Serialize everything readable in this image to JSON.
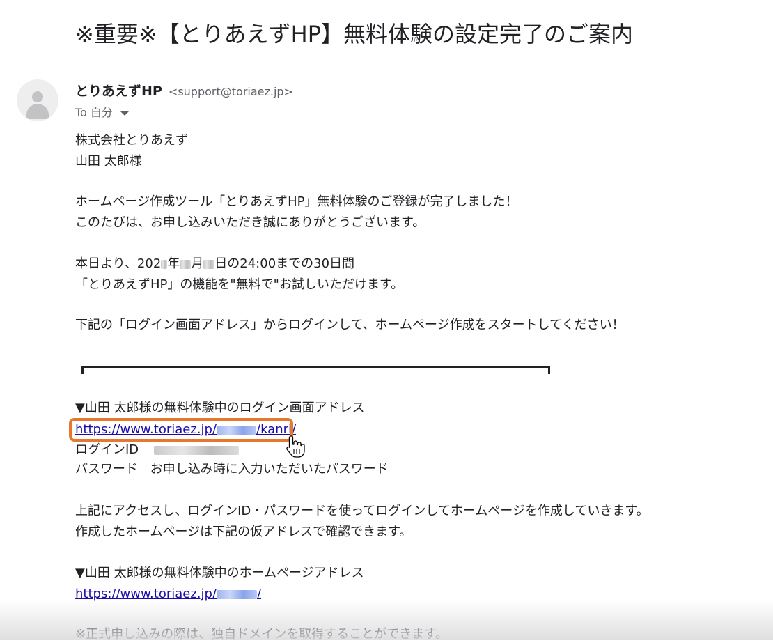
{
  "email": {
    "subject": "※重要※【とりあえずHP】無料体験の設定完了のご案内",
    "sender": {
      "name": "とりあえずHP",
      "email": "<support@toriaez.jp>"
    },
    "recipient": "To 自分",
    "body": {
      "company": "株式会社とりあえず",
      "addressee": "山田 太郎様",
      "intro_1": "ホームページ作成ツール「とりあえずHP」無料体験のご登録が完了しました！",
      "intro_2": "このたびは、お申し込みいただき誠にありがとうございます。",
      "trial_pre": "本日より、202",
      "trial_year": "年",
      "trial_month": "月",
      "trial_post": "日の24:00までの30日間",
      "trial_2": "「とりあえずHP」の機能を\"無料で\"お試しいただけます。",
      "instruction": "下記の「ログイン画面アドレス」からログインして、ホームページ作成をスタートしてください！",
      "login_heading": "▼山田 太郎様の無料体験中のログイン画面アドレス",
      "login_url_prefix": "https://www.toriaez.jp/",
      "login_url_suffix": "/kanri/",
      "login_id_label": "ログインID",
      "password_label": "パスワード",
      "password_value": "お申し込み時に入力いただいたパスワード",
      "access_1": "上記にアクセスし、ログインID・パスワードを使ってログインしてホームページを作成していきます。",
      "access_2": "作成したホームページは下記の仮アドレスで確認できます。",
      "homepage_heading": "▼山田 太郎様の無料体験中のホームページアドレス",
      "homepage_url_prefix": "https://www.toriaez.jp/",
      "homepage_url_suffix": "/",
      "note": "※正式申し込みの際は、独自ドメインを取得することができます。"
    }
  },
  "colors": {
    "link": "#1a0dab",
    "highlight": "#e8772e",
    "text": "#202124",
    "muted": "#5f6368"
  },
  "icons": {
    "avatar": "person-avatar-icon",
    "caret": "caret-down-icon",
    "cursor": "hand-pointer-cursor-icon"
  }
}
